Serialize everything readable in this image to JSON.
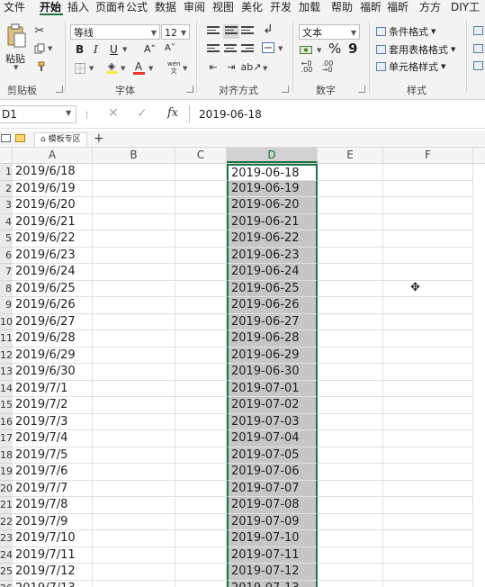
{
  "tabs": [
    "文件",
    "开始",
    "插入",
    "页面布",
    "公式",
    "数据",
    "审阅",
    "视图",
    "美化",
    "开发",
    "加载",
    "帮助",
    "福昕",
    "福昕",
    "方方",
    "DIY工"
  ],
  "active_tab": "开始",
  "ribbon": {
    "clipboard": {
      "paste_label": "粘贴",
      "group_label": "剪贴板"
    },
    "font": {
      "font_name": "等线",
      "font_size": "12",
      "bold": "B",
      "italic": "I",
      "underline": "U",
      "grow": "A˄",
      "shrink": "A˅",
      "wen": "wén\n文",
      "group_label": "字体",
      "font_color": "#e5372b",
      "highlight_color": "#fbe94a"
    },
    "alignment": {
      "group_label": "对齐方式"
    },
    "number": {
      "format": "文本",
      "percent": "%",
      "comma": "9",
      "group_label": "数字"
    },
    "styles": {
      "cond_format": "条件格式",
      "table_format": "套用表格格式",
      "cell_style": "单元格样式",
      "group_label": "样式"
    }
  },
  "formula_bar": {
    "name_box": "D1",
    "cancel": "✕",
    "confirm": "✓",
    "fx": "fx",
    "content": "2019-06-18"
  },
  "doc_tabs": {
    "template_tab": "模板专区",
    "add": "+"
  },
  "grid": {
    "columns": [
      "A",
      "B",
      "C",
      "D",
      "E",
      "F"
    ],
    "selected_column": "D",
    "rows": [
      {
        "n": "1",
        "a": "2019/6/18",
        "d": "2019-06-18"
      },
      {
        "n": "2",
        "a": "2019/6/19",
        "d": "2019-06-19"
      },
      {
        "n": "3",
        "a": "2019/6/20",
        "d": "2019-06-20"
      },
      {
        "n": "4",
        "a": "2019/6/21",
        "d": "2019-06-21"
      },
      {
        "n": "5",
        "a": "2019/6/22",
        "d": "2019-06-22"
      },
      {
        "n": "6",
        "a": "2019/6/23",
        "d": "2019-06-23"
      },
      {
        "n": "7",
        "a": "2019/6/24",
        "d": "2019-06-24"
      },
      {
        "n": "8",
        "a": "2019/6/25",
        "d": "2019-06-25"
      },
      {
        "n": "9",
        "a": "2019/6/26",
        "d": "2019-06-26"
      },
      {
        "n": "10",
        "a": "2019/6/27",
        "d": "2019-06-27"
      },
      {
        "n": "11",
        "a": "2019/6/28",
        "d": "2019-06-28"
      },
      {
        "n": "12",
        "a": "2019/6/29",
        "d": "2019-06-29"
      },
      {
        "n": "13",
        "a": "2019/6/30",
        "d": "2019-06-30"
      },
      {
        "n": "14",
        "a": "2019/7/1",
        "d": "2019-07-01"
      },
      {
        "n": "15",
        "a": "2019/7/2",
        "d": "2019-07-02"
      },
      {
        "n": "16",
        "a": "2019/7/3",
        "d": "2019-07-03"
      },
      {
        "n": "17",
        "a": "2019/7/4",
        "d": "2019-07-04"
      },
      {
        "n": "18",
        "a": "2019/7/5",
        "d": "2019-07-05"
      },
      {
        "n": "19",
        "a": "2019/7/6",
        "d": "2019-07-06"
      },
      {
        "n": "20",
        "a": "2019/7/7",
        "d": "2019-07-07"
      },
      {
        "n": "21",
        "a": "2019/7/8",
        "d": "2019-07-08"
      },
      {
        "n": "22",
        "a": "2019/7/9",
        "d": "2019-07-09"
      },
      {
        "n": "23",
        "a": "2019/7/10",
        "d": "2019-07-10"
      },
      {
        "n": "24",
        "a": "2019/7/11",
        "d": "2019-07-11"
      },
      {
        "n": "25",
        "a": "2019/7/12",
        "d": "2019-07-12"
      },
      {
        "n": "26",
        "a": "2019/7/13",
        "d": "2019-07-13"
      }
    ]
  }
}
